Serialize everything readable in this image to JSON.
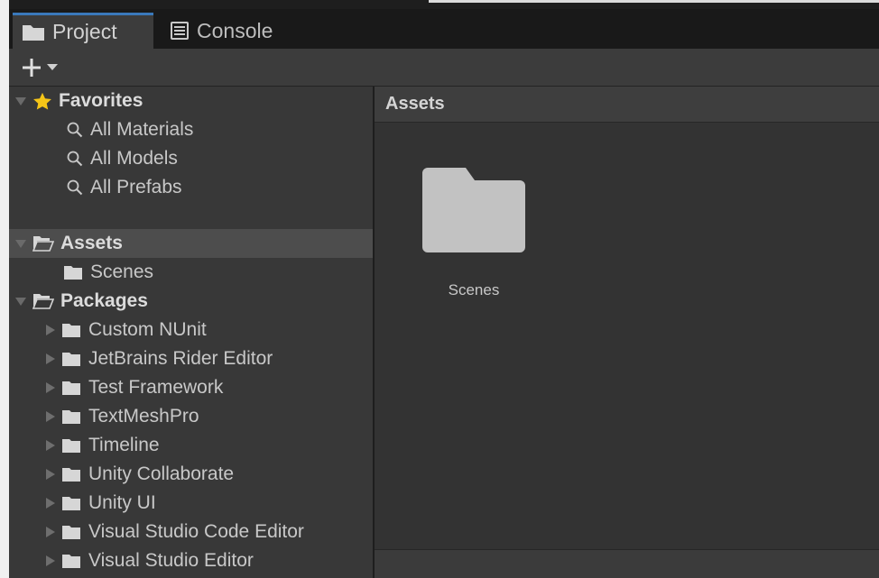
{
  "tabs": [
    {
      "label": "Project",
      "icon": "folder-icon",
      "active": true
    },
    {
      "label": "Console",
      "icon": "console-icon",
      "active": false
    }
  ],
  "toolbar": {
    "add_icon": "plus-icon",
    "dropdown_icon": "caret-down-icon"
  },
  "tree": {
    "favorites": {
      "label": "Favorites",
      "icon": "star-icon",
      "items": [
        {
          "label": "All Materials",
          "icon": "search-icon"
        },
        {
          "label": "All Models",
          "icon": "search-icon"
        },
        {
          "label": "All Prefabs",
          "icon": "search-icon"
        }
      ]
    },
    "assets": {
      "label": "Assets",
      "icon": "folder-open-icon",
      "items": [
        {
          "label": "Scenes",
          "icon": "folder-icon"
        }
      ]
    },
    "packages": {
      "label": "Packages",
      "icon": "folder-open-icon",
      "items": [
        {
          "label": "Custom NUnit"
        },
        {
          "label": "JetBrains Rider Editor"
        },
        {
          "label": "Test Framework"
        },
        {
          "label": "TextMeshPro"
        },
        {
          "label": "Timeline"
        },
        {
          "label": "Unity Collaborate"
        },
        {
          "label": "Unity UI"
        },
        {
          "label": "Visual Studio Code Editor"
        },
        {
          "label": "Visual Studio Editor"
        }
      ]
    }
  },
  "content": {
    "header": "Assets",
    "items": [
      {
        "label": "Scenes",
        "icon": "folder-icon"
      }
    ]
  },
  "colors": {
    "accent": "#3a79bb",
    "favorite_star": "#f5c518",
    "tree_bg": "#383838",
    "content_bg": "#333333",
    "selected_row": "#4d4d4d"
  }
}
